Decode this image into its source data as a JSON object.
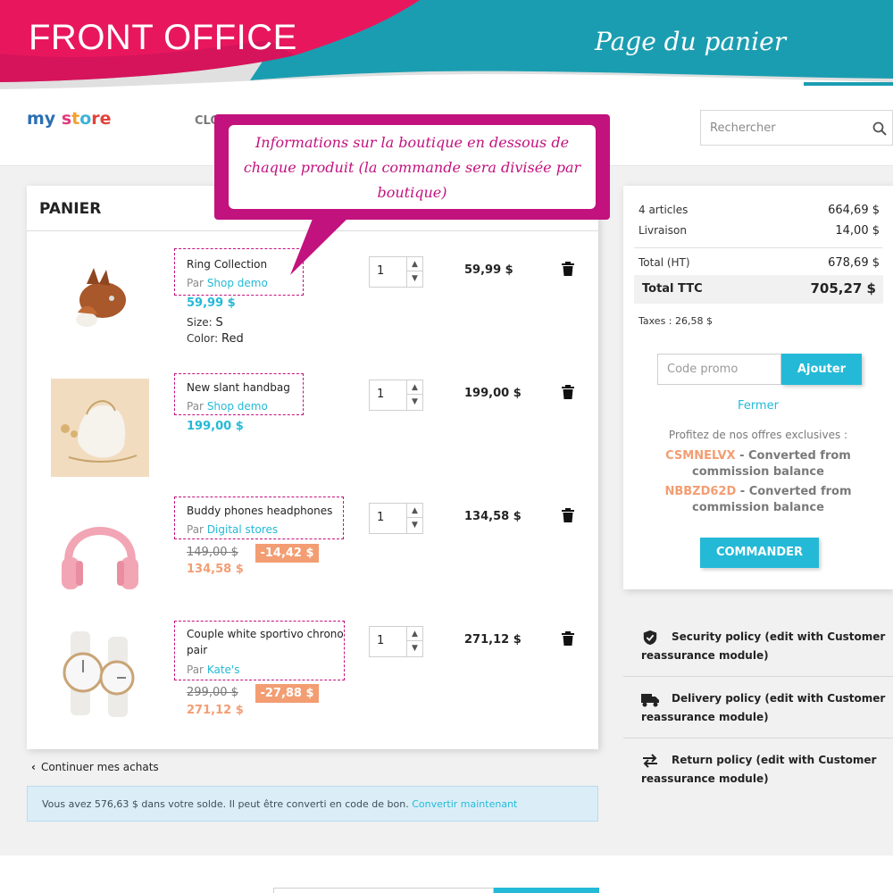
{
  "banner": {
    "left_title": "FRONT OFFICE",
    "right_title": "Page du panier"
  },
  "header": {
    "logo": {
      "part1": "my",
      "part2": "s",
      "part3": "t",
      "part4": "o",
      "part5": "re"
    },
    "nav_item": "CLO",
    "search": {
      "placeholder": "Rechercher"
    }
  },
  "callout": {
    "text": "Informations sur la boutique en dessous de chaque produit (la commande sera divisée par boutique)"
  },
  "cart": {
    "title": "PANIER",
    "by_label": "Par",
    "items": [
      {
        "name": "Ring Collection",
        "shop": "Shop demo",
        "price": "59,99 $",
        "attr1_label": "Size:",
        "attr1_value": "S",
        "attr2_label": "Color:",
        "attr2_value": "Red",
        "qty": "1",
        "total": "59,99 $",
        "image": "fox-purse-image"
      },
      {
        "name": "New slant handbag",
        "shop": "Shop demo",
        "price": "199,00 $",
        "qty": "1",
        "total": "199,00 $",
        "image": "white-handbag-image"
      },
      {
        "name": "Buddy phones headphones",
        "shop": "Digital stores",
        "regular_price": "149,00 $",
        "discount": "-14,42 $",
        "price": "134,58 $",
        "qty": "1",
        "total": "134,58 $",
        "image": "pink-headphones-image"
      },
      {
        "name_line1": "Couple white sportivo chrono",
        "name_line2": "pair",
        "shop": "Kate's",
        "regular_price": "299,00 $",
        "discount": "-27,88 $",
        "price": "271,12 $",
        "qty": "1",
        "total": "271,12 $",
        "image": "white-watches-image"
      }
    ],
    "continue_label": "Continuer mes achats",
    "notice": {
      "text": "Vous avez 576,63 $ dans votre solde. Il peut être converti en code de bon.",
      "link": "Convertir maintenant"
    }
  },
  "summary": {
    "articles_label": "4 articles",
    "articles_value": "664,69 $",
    "shipping_label": "Livraison",
    "shipping_value": "14,00 $",
    "total_ht_label": "Total (HT)",
    "total_ht_value": "678,69 $",
    "total_ttc_label": "Total TTC",
    "total_ttc_value": "705,27 $",
    "taxes": "Taxes : 26,58 $",
    "promo_placeholder": "Code promo",
    "promo_button": "Ajouter",
    "close_label": "Fermer",
    "offers_title": "Profitez de nos offres exclusives :",
    "codes": [
      {
        "code": "CSMNELVX",
        "line1": "- Converted from",
        "line2": "commission balance"
      },
      {
        "code": "NBBZD62D",
        "line1": "- Converted from",
        "line2": "commission balance"
      }
    ],
    "order_button": "COMMANDER"
  },
  "reassurance": [
    {
      "icon": "shield-icon",
      "text": "Security policy (edit with Customer reassurance module)"
    },
    {
      "icon": "truck-icon",
      "text": "Delivery policy (edit with Customer reassurance module)"
    },
    {
      "icon": "exchange-icon",
      "text": "Return policy (edit with Customer reassurance module)"
    }
  ],
  "colors": {
    "magenta": "#c2127d",
    "pink": "#e8175d",
    "teal": "#1a9fb3",
    "accent": "#24b9d7",
    "discount": "#f39d72"
  }
}
